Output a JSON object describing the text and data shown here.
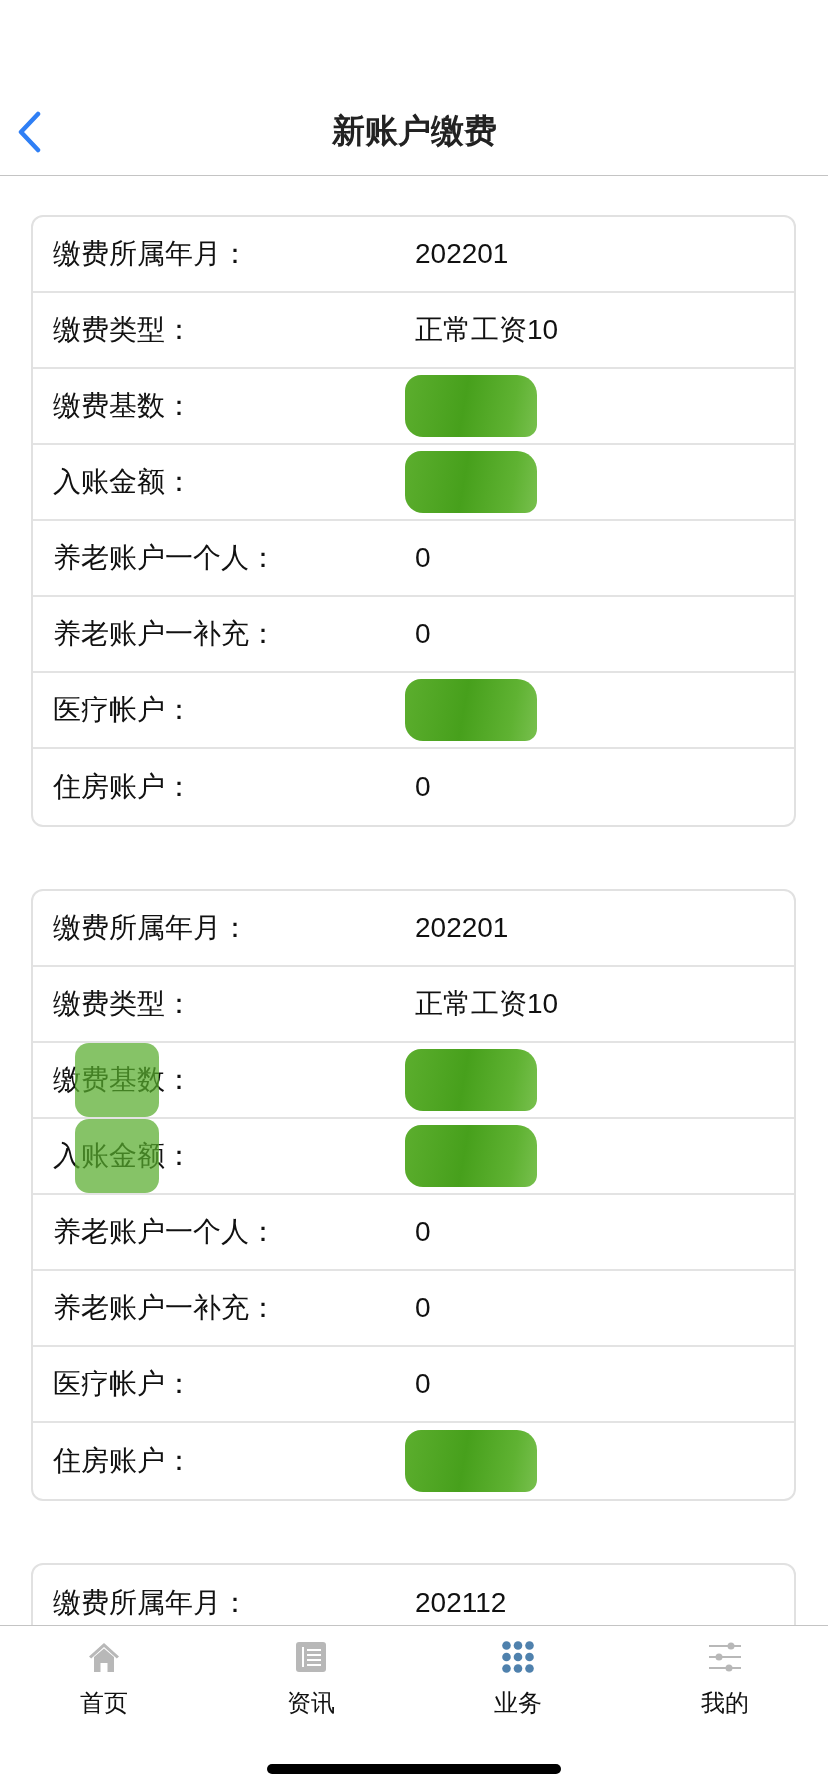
{
  "header": {
    "title": "新账户缴费"
  },
  "records": [
    {
      "rows": [
        {
          "label": "缴费所属年月：",
          "value": "202201",
          "redacted": false,
          "label_redacted": false
        },
        {
          "label": "缴费类型：",
          "value": "正常工资10",
          "redacted": false,
          "label_redacted": false
        },
        {
          "label": "缴费基数：",
          "redacted": true,
          "label_redacted": false
        },
        {
          "label": "入账金额：",
          "redacted": true,
          "label_redacted": false
        },
        {
          "label": "养老账户一个人：",
          "value": "0",
          "redacted": false,
          "label_redacted": false
        },
        {
          "label": "养老账户一补充：",
          "value": "0",
          "redacted": false,
          "label_redacted": false
        },
        {
          "label": "医疗帐户：",
          "redacted": true,
          "label_redacted": false
        },
        {
          "label": "住房账户：",
          "value": "0",
          "redacted": false,
          "label_redacted": false
        }
      ]
    },
    {
      "rows": [
        {
          "label": "缴费所属年月：",
          "value": "202201",
          "redacted": false,
          "label_redacted": false
        },
        {
          "label": "缴费类型：",
          "value": "正常工资10",
          "redacted": false,
          "label_redacted": false
        },
        {
          "label": "缴费基数：",
          "redacted": true,
          "label_redacted": true
        },
        {
          "label": "入账金额：",
          "redacted": true,
          "label_redacted": true
        },
        {
          "label": "养老账户一个人：",
          "value": "0",
          "redacted": false,
          "label_redacted": false
        },
        {
          "label": "养老账户一补充：",
          "value": "0",
          "redacted": false,
          "label_redacted": false
        },
        {
          "label": "医疗帐户：",
          "value": "0",
          "redacted": false,
          "label_redacted": false
        },
        {
          "label": "住房账户：",
          "redacted": true,
          "label_redacted": false
        }
      ]
    },
    {
      "rows": [
        {
          "label": "缴费所属年月：",
          "value": "202112",
          "redacted": false,
          "label_redacted": false
        }
      ]
    }
  ],
  "tabs": [
    {
      "label": "首页",
      "selected": false
    },
    {
      "label": "资讯",
      "selected": false
    },
    {
      "label": "业务",
      "selected": true
    },
    {
      "label": "我的",
      "selected": false
    }
  ]
}
